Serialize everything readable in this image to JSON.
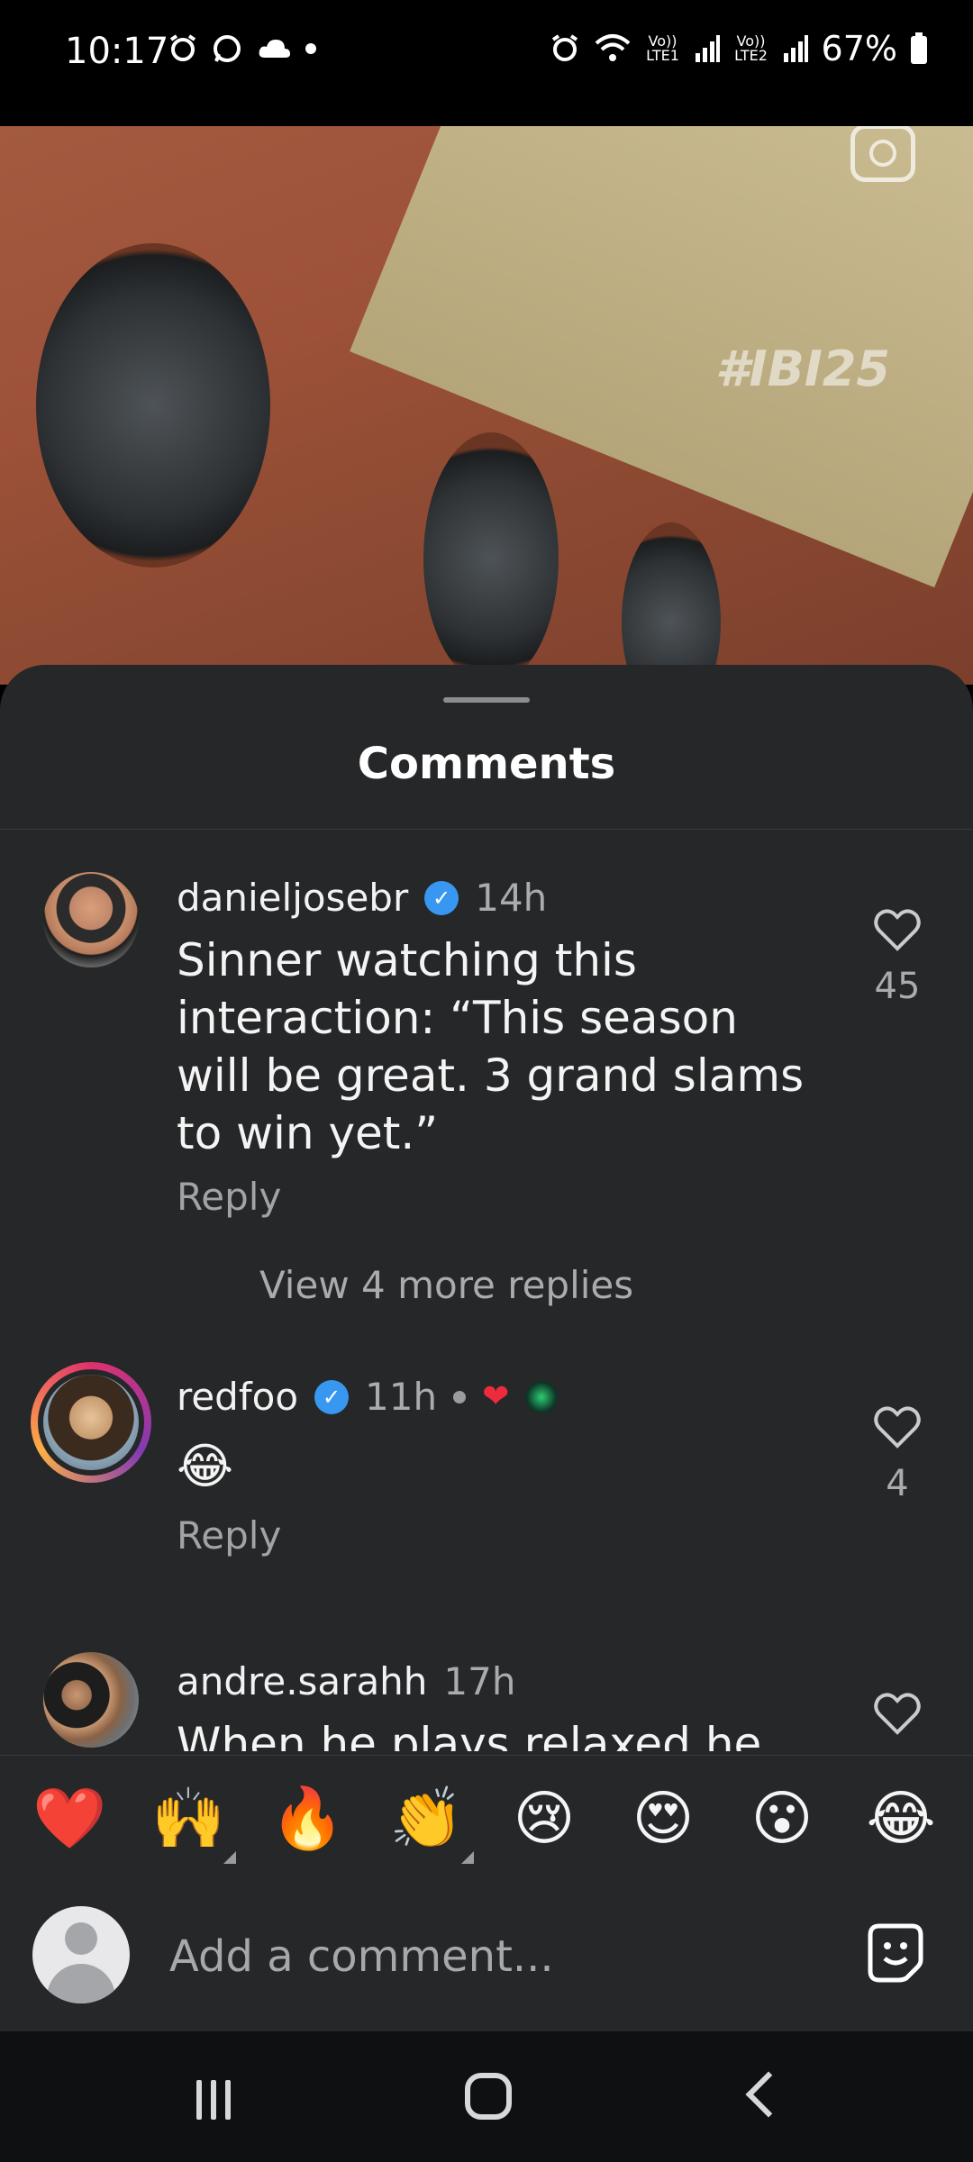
{
  "status_bar": {
    "time": "10:17",
    "battery": "67%",
    "sim1": "Vo)) LTE1",
    "sim2": "Vo)) LTE2"
  },
  "video": {
    "hashtag_overlay": "#IBI25"
  },
  "sheet": {
    "title": "Comments"
  },
  "comments": [
    {
      "username": "danieljosebr",
      "verified": true,
      "time": "14h",
      "text": "Sinner watching this interaction: “This season will be great. 3 grand slams to win yet.”",
      "reply_label": "Reply",
      "likes": "45",
      "view_replies": "View 4 more replies"
    },
    {
      "username": "redfoo",
      "verified": true,
      "time": "11h",
      "text": "😂",
      "reply_label": "Reply",
      "likes": "4"
    },
    {
      "username": "andre.sarahh",
      "verified": false,
      "time": "17h",
      "text": "When he plays relaxed he",
      "likes": ""
    }
  ],
  "emoji_bar": [
    "❤️",
    "🙌",
    "🔥",
    "👏",
    "😢",
    "😍",
    "😮",
    "😂"
  ],
  "composer": {
    "placeholder": "Add a comment..."
  },
  "colors": {
    "sheet_bg": "#262729",
    "verified_blue": "#3897f0",
    "story_ring": "#e1306c"
  }
}
